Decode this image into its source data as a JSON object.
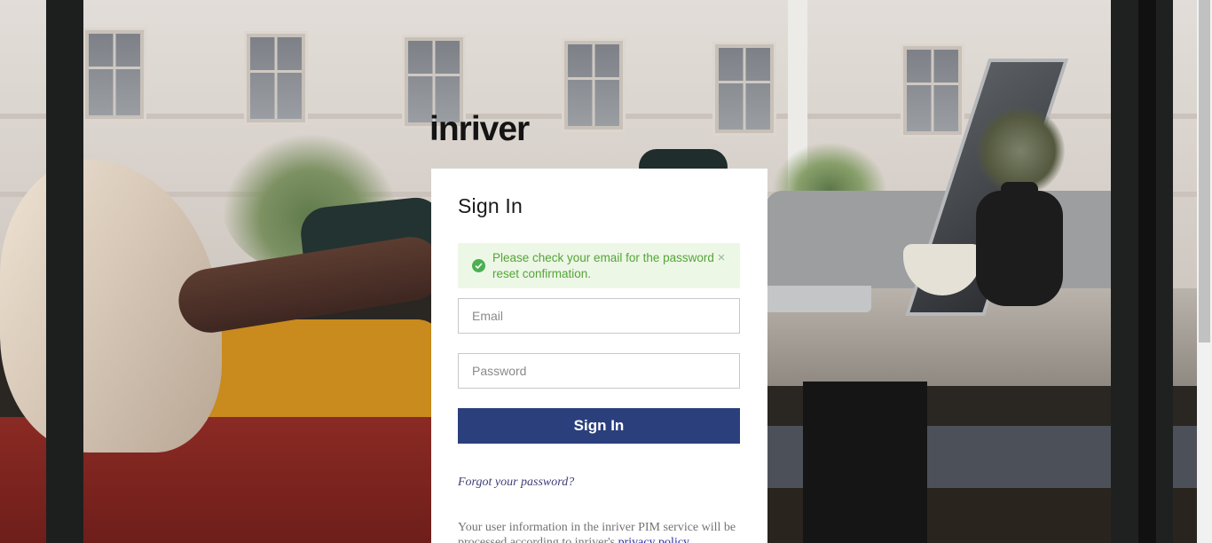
{
  "brand": {
    "logo_text": "inriver"
  },
  "signin": {
    "title": "Sign In",
    "alert": {
      "type": "success",
      "icon": "check-circle-icon",
      "message": "Please check your email for the password reset confirmation.",
      "close_glyph": "×"
    },
    "email": {
      "placeholder": "Email",
      "value": ""
    },
    "password": {
      "placeholder": "Password",
      "value": ""
    },
    "submit_label": "Sign In",
    "forgot_link": "Forgot your password?",
    "privacy_text": "Your user information in the inriver PIM service will be processed according to inriver's",
    "privacy_link": "privacy policy"
  },
  "colors": {
    "primary_button": "#2b3f7c",
    "alert_background": "#edf7e6",
    "alert_text": "#55a43a",
    "link": "#3d3f78"
  }
}
